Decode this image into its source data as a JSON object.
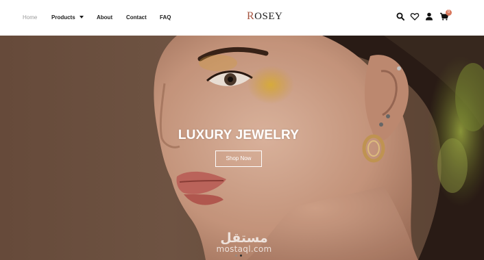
{
  "brand": {
    "logo_first": "R",
    "logo_rest": "OSEY",
    "accent_color": "#a6543f"
  },
  "nav": {
    "items": [
      {
        "label": "Home",
        "active": true
      },
      {
        "label": "Products",
        "has_dropdown": true
      },
      {
        "label": "About"
      },
      {
        "label": "Contact"
      },
      {
        "label": "FAQ"
      }
    ]
  },
  "header_icons": [
    {
      "name": "search-icon"
    },
    {
      "name": "heart-icon"
    },
    {
      "name": "user-icon"
    },
    {
      "name": "cart-icon"
    }
  ],
  "cart": {
    "badge_count": "0",
    "badge_color": "#d9795f"
  },
  "hero": {
    "title": "LUXURY JEWELRY",
    "button_label": "Shop Now",
    "background_color": "#6d5140",
    "slide_count": 2,
    "active_slide": 2
  },
  "watermark": {
    "arabic": "مستقل",
    "latin": "mostaql.com"
  }
}
